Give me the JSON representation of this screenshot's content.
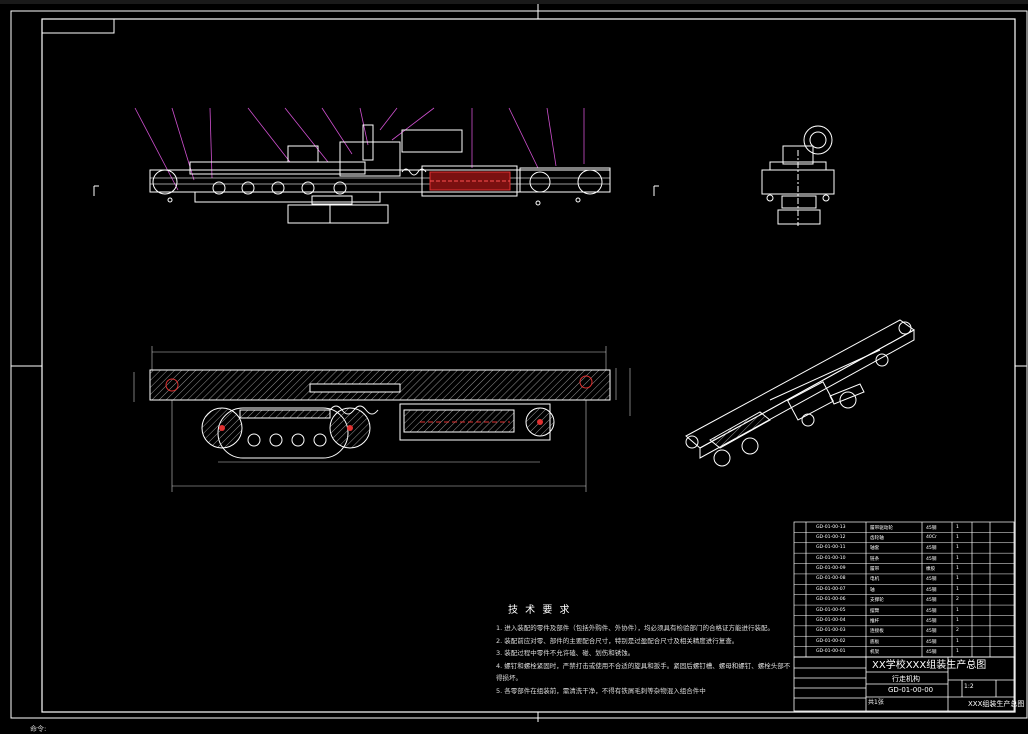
{
  "drawing": {
    "title": "XX学校XXX组装生产总图",
    "subtitle": "行走机构",
    "drawing_code": "GD-01-00-00",
    "scale": "1:2",
    "sheet_label": "XXX组装生产总图",
    "page_note": "共1张"
  },
  "tech_requirements": {
    "heading": "技 术 要 求",
    "items": [
      "1. 进入装配的零件及部件（包括外购件、外协件），均必须具有检验部门的合格证方能进行装配。",
      "2. 装配前应对零、部件的主要配合尺寸，特别是过盈配合尺寸及相关精度进行复查。",
      "3. 装配过程中零件不允许磕、碰、划伤和锈蚀。",
      "4. 螺钉和螺栓紧固时，严禁打击或使用不合适的旋具和扳手。紧固后螺钉槽、螺母和螺钉、螺栓头部不",
      "   得损坏。",
      "5. 各零部件在组装前，需清洗干净，不得有铁屑毛刺等杂物混入组合件中"
    ]
  },
  "bom": {
    "rows": [
      {
        "code": "GD-01-00-13",
        "name": "履带驱动轮",
        "mat": "45钢",
        "qty": "1"
      },
      {
        "code": "GD-01-00-12",
        "name": "齿轮轴",
        "mat": "40Cr",
        "qty": "1"
      },
      {
        "code": "GD-01-00-11",
        "name": "轴套",
        "mat": "45钢",
        "qty": "1"
      },
      {
        "code": "GD-01-00-10",
        "name": "链条",
        "mat": "45钢",
        "qty": "1"
      },
      {
        "code": "GD-01-00-09",
        "name": "履带",
        "mat": "橡胶",
        "qty": "1"
      },
      {
        "code": "GD-01-00-08",
        "name": "电机",
        "mat": "45钢",
        "qty": "1"
      },
      {
        "code": "GD-01-00-07",
        "name": "轴",
        "mat": "45钢",
        "qty": "1"
      },
      {
        "code": "GD-01-00-06",
        "name": "支撑轮",
        "mat": "45钢",
        "qty": "2"
      },
      {
        "code": "GD-01-00-05",
        "name": "摆臂",
        "mat": "45钢",
        "qty": "1"
      },
      {
        "code": "GD-01-00-04",
        "name": "推杆",
        "mat": "45钢",
        "qty": "1"
      },
      {
        "code": "GD-01-00-03",
        "name": "连接板",
        "mat": "45钢",
        "qty": "2"
      },
      {
        "code": "GD-01-00-02",
        "name": "底板",
        "mat": "45钢",
        "qty": "1"
      },
      {
        "code": "GD-01-00-01",
        "name": "机架",
        "mat": "45钢",
        "qty": "1"
      }
    ]
  },
  "command_line": "命令:"
}
